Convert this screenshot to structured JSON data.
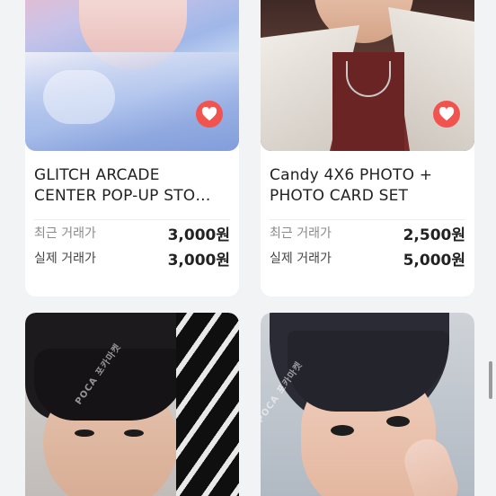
{
  "cards": [
    {
      "title_line1": "GLITCH ARCADE",
      "title_line2": "CENTER POP-UP STO…",
      "recent_label": "최근 거래가",
      "recent_price": "3,000원",
      "actual_label": "실제 거래가",
      "actual_price": "3,000원",
      "liked": true
    },
    {
      "title_line1": "Candy 4X6 PHOTO +",
      "title_line2": "PHOTO CARD SET",
      "recent_label": "최근 거래가",
      "recent_price": "2,500원",
      "actual_label": "실제 거래가",
      "actual_price": "5,000원",
      "liked": true
    }
  ],
  "watermark_text": "POCA 포카마켓",
  "colors": {
    "background": "#f2f3f5",
    "card": "#ffffff",
    "heart": "#f1544f",
    "muted_text": "#8a8a8a",
    "main_text": "#222222"
  },
  "icons": {
    "like": "heart-icon"
  }
}
